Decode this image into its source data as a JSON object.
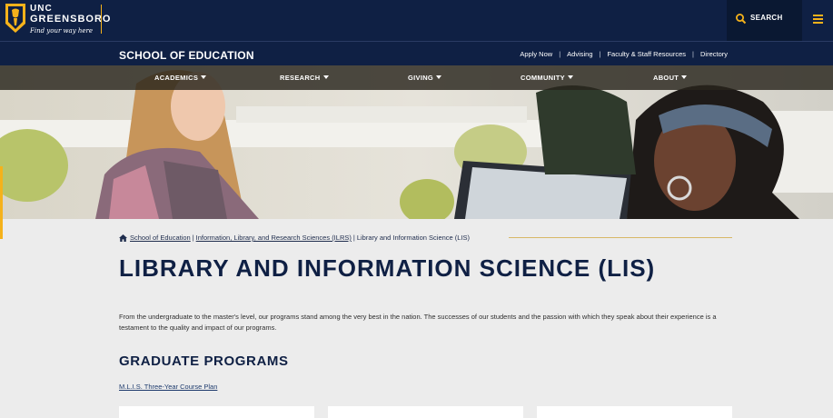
{
  "header": {
    "logo_line1": "UNC",
    "logo_line2": "GREENSBORO",
    "logo_tagline": "Find your way here",
    "search_label": "SEARCH"
  },
  "school_bar": {
    "title": "SCHOOL OF EDUCATION",
    "links": [
      "Apply Now",
      "Advising",
      "Faculty & Staff Resources",
      "Directory"
    ]
  },
  "nav": {
    "items": [
      "ACADEMICS",
      "RESEARCH",
      "GIVING",
      "COMMUNITY",
      "ABOUT"
    ]
  },
  "breadcrumb": {
    "items": [
      "School of Education",
      "Information, Library, and Research Sciences (ILRS)"
    ],
    "current": "Library and Information Science (LIS)"
  },
  "page": {
    "title": "LIBRARY AND INFORMATION SCIENCE (LIS)",
    "intro": "From the undergraduate to the master's level, our programs stand among the very best in the nation. The successes of our students and the passion with which they speak about their experience is a testament to the quality and impact of our programs.",
    "section_title": "GRADUATE PROGRAMS",
    "course_link": "M.L.I.S. Three-Year Course Plan"
  },
  "colors": {
    "navy": "#0f2044",
    "gold": "#f5b21b"
  }
}
